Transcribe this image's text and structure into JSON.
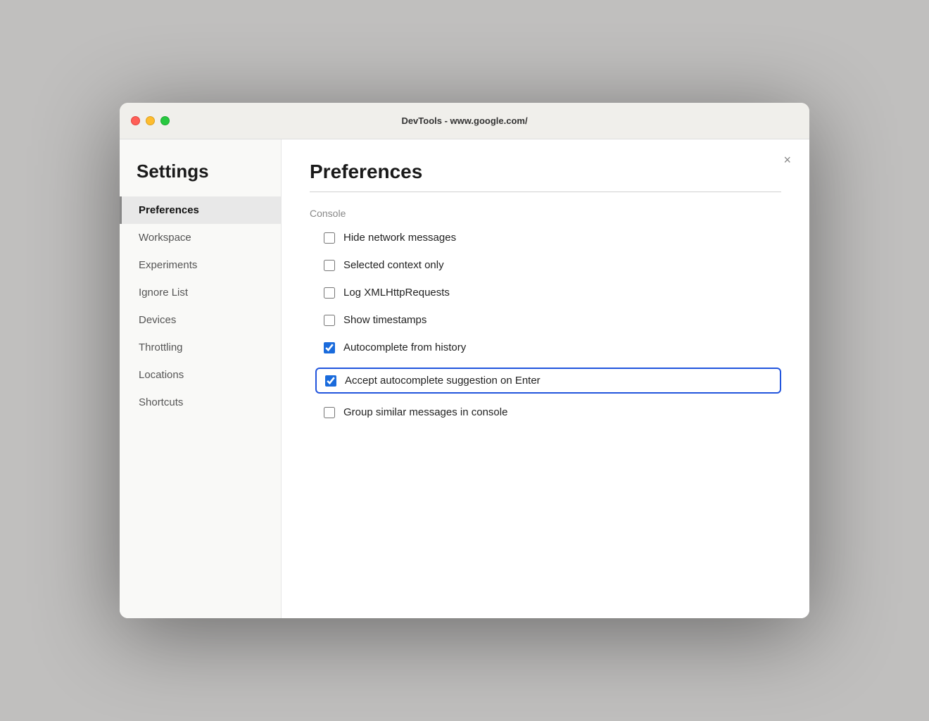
{
  "window": {
    "title": "DevTools - www.google.com/"
  },
  "sidebar": {
    "heading": "Settings",
    "items": [
      {
        "id": "preferences",
        "label": "Preferences",
        "active": true
      },
      {
        "id": "workspace",
        "label": "Workspace",
        "active": false
      },
      {
        "id": "experiments",
        "label": "Experiments",
        "active": false
      },
      {
        "id": "ignore-list",
        "label": "Ignore List",
        "active": false
      },
      {
        "id": "devices",
        "label": "Devices",
        "active": false
      },
      {
        "id": "throttling",
        "label": "Throttling",
        "active": false
      },
      {
        "id": "locations",
        "label": "Locations",
        "active": false
      },
      {
        "id": "shortcuts",
        "label": "Shortcuts",
        "active": false
      }
    ]
  },
  "main": {
    "title": "Preferences",
    "close_button": "×",
    "section": {
      "label": "Console",
      "checkboxes": [
        {
          "id": "hide-network",
          "label": "Hide network messages",
          "checked": false,
          "highlighted": false
        },
        {
          "id": "selected-context",
          "label": "Selected context only",
          "checked": false,
          "highlighted": false
        },
        {
          "id": "log-xhr",
          "label": "Log XMLHttpRequests",
          "checked": false,
          "highlighted": false
        },
        {
          "id": "show-timestamps",
          "label": "Show timestamps",
          "checked": false,
          "highlighted": false
        },
        {
          "id": "autocomplete-history",
          "label": "Autocomplete from history",
          "checked": true,
          "highlighted": false
        },
        {
          "id": "accept-autocomplete",
          "label": "Accept autocomplete suggestion on Enter",
          "checked": true,
          "highlighted": true
        },
        {
          "id": "group-similar",
          "label": "Group similar messages in console",
          "checked": false,
          "highlighted": false
        }
      ]
    }
  },
  "traffic_lights": {
    "close_color": "#ff5f57",
    "minimize_color": "#febc2e",
    "maximize_color": "#28c840"
  }
}
